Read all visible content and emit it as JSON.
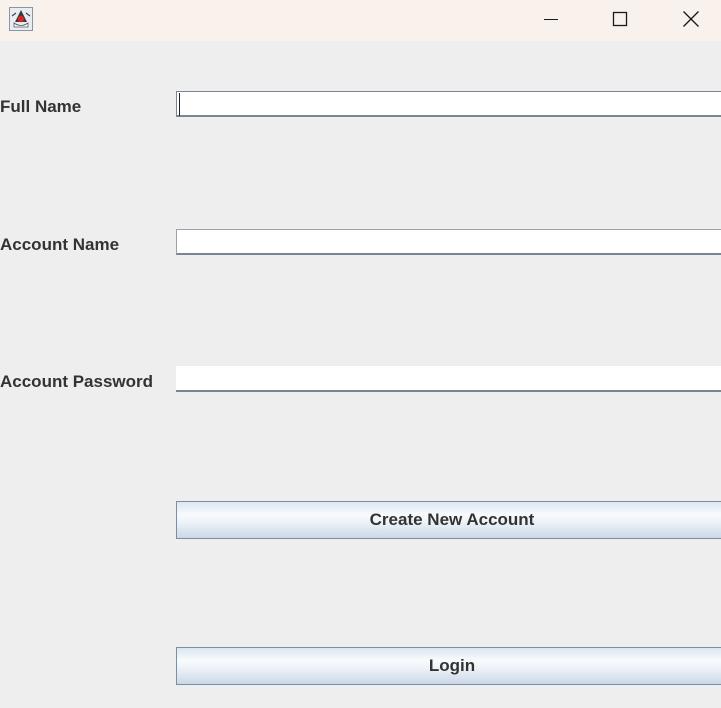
{
  "window": {
    "icon": "java-duke-icon",
    "controls": {
      "minimize": "minimize-icon",
      "maximize": "maximize-icon",
      "close": "close-icon"
    }
  },
  "form": {
    "full_name": {
      "label": "Full Name",
      "value": ""
    },
    "account_name": {
      "label": "Account Name",
      "value": ""
    },
    "account_password": {
      "label": "Account Password",
      "value": ""
    }
  },
  "buttons": {
    "create_account": "Create New Account",
    "login": "Login"
  },
  "colors": {
    "titlebar": "#f9f1ec",
    "background": "#eeeeee",
    "label_text": "#333333",
    "button_border": "#7a8ea6"
  }
}
